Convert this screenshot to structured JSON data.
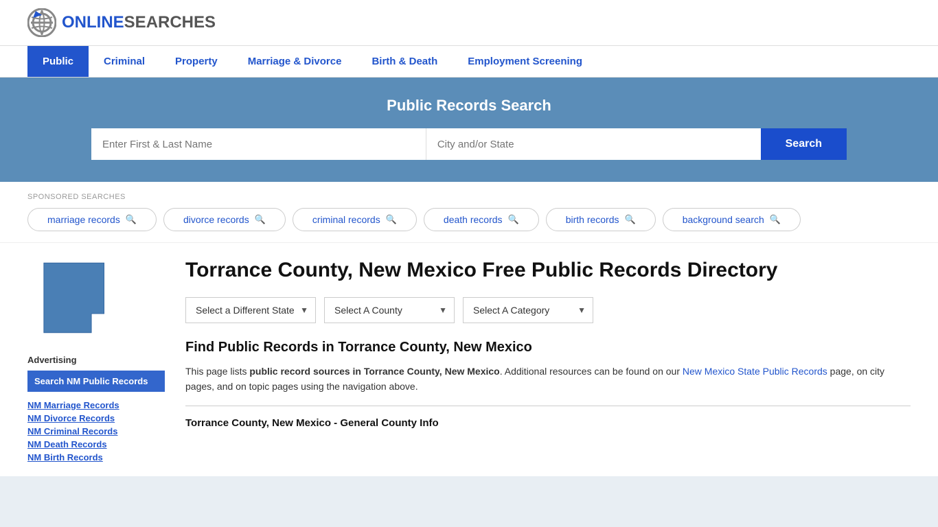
{
  "header": {
    "logo_online": "ONLINE",
    "logo_searches": "SEARCHES",
    "logo_combined": "ONLINESEARCHES"
  },
  "nav": {
    "items": [
      {
        "label": "Public",
        "active": true
      },
      {
        "label": "Criminal",
        "active": false
      },
      {
        "label": "Property",
        "active": false
      },
      {
        "label": "Marriage & Divorce",
        "active": false
      },
      {
        "label": "Birth & Death",
        "active": false
      },
      {
        "label": "Employment Screening",
        "active": false
      }
    ]
  },
  "hero": {
    "title": "Public Records Search",
    "name_placeholder": "Enter First & Last Name",
    "location_placeholder": "City and/or State",
    "search_label": "Search"
  },
  "sponsored": {
    "label": "SPONSORED SEARCHES",
    "pills": [
      {
        "text": "marriage records"
      },
      {
        "text": "divorce records"
      },
      {
        "text": "criminal records"
      },
      {
        "text": "death records"
      },
      {
        "text": "birth records"
      },
      {
        "text": "background search"
      }
    ]
  },
  "sidebar": {
    "advertising_label": "Advertising",
    "ad_box_text": "Search NM Public Records",
    "links": [
      {
        "text": "NM Marriage Records"
      },
      {
        "text": "NM Divorce Records"
      },
      {
        "text": "NM Criminal Records"
      },
      {
        "text": "NM Death Records"
      },
      {
        "text": "NM Birth Records"
      }
    ]
  },
  "main": {
    "page_title": "Torrance County, New Mexico Free Public Records Directory",
    "dropdowns": {
      "state_label": "Select a Different State",
      "county_label": "Select A County",
      "category_label": "Select A Category"
    },
    "find_heading": "Find Public Records in Torrance County, New Mexico",
    "description_text_1": "This page lists ",
    "description_bold": "public record sources in Torrance County, New Mexico",
    "description_text_2": ". Additional resources can be found on our ",
    "link_text": "New Mexico State Public Records",
    "description_text_3": " page, on city pages, and on topic pages using the navigation above.",
    "general_info_heading": "Torrance County, New Mexico - General County Info"
  }
}
